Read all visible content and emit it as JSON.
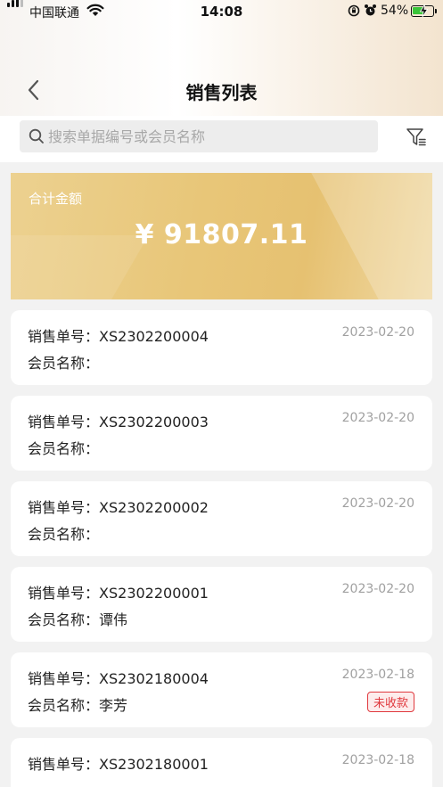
{
  "status_bar": {
    "carrier": "中国联通",
    "time": "14:08",
    "battery": "54%"
  },
  "nav": {
    "title": "销售列表"
  },
  "search": {
    "placeholder": "搜索单据编号或会员名称",
    "value": ""
  },
  "summary": {
    "label": "合计金额",
    "amount": "¥ 91807.11"
  },
  "labels": {
    "order_no": "销售单号：",
    "member": "会员名称："
  },
  "orders": [
    {
      "order_no": "XS2302200004",
      "date": "2023-02-20",
      "member": "",
      "badge": ""
    },
    {
      "order_no": "XS2302200003",
      "date": "2023-02-20",
      "member": "",
      "badge": ""
    },
    {
      "order_no": "XS2302200002",
      "date": "2023-02-20",
      "member": "",
      "badge": ""
    },
    {
      "order_no": "XS2302200001",
      "date": "2023-02-20",
      "member": "谭伟",
      "badge": ""
    },
    {
      "order_no": "XS2302180004",
      "date": "2023-02-18",
      "member": "李芳",
      "badge": "未收款"
    },
    {
      "order_no": "XS2302180001",
      "date": "2023-02-18",
      "member": "",
      "badge": ""
    }
  ],
  "colors": {
    "summary_gold": "#e8c678",
    "badge_red": "#e0393e"
  }
}
